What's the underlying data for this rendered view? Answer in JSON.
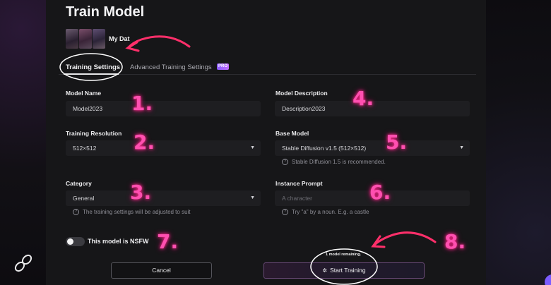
{
  "modal": {
    "title": "Train Model",
    "dataset_name": "My Dat",
    "tabs": [
      {
        "label": "Training Settings",
        "active": true
      },
      {
        "label": "Advanced Training Settings",
        "active": false
      }
    ],
    "pro_badge": "PRO"
  },
  "form": {
    "model_name": {
      "label": "Model Name",
      "value": "Model2023"
    },
    "model_description": {
      "label": "Model Description",
      "value": "Description2023"
    },
    "training_resolution": {
      "label": "Training Resolution",
      "value": "512×512"
    },
    "base_model": {
      "label": "Base Model",
      "value": "Stable Diffusion v1.5 (512×512)",
      "hint": "Stable Diffusion 1.5 is recommended."
    },
    "category": {
      "label": "Category",
      "value": "General",
      "hint": "The training settings will be adjusted to suit"
    },
    "instance_prompt": {
      "label": "Instance Prompt",
      "placeholder": "A character",
      "hint": "Try \"a\" by a noun. E.g. a castle"
    },
    "nsfw_toggle": {
      "label": "This model is NSFW",
      "on": false
    }
  },
  "footer": {
    "cancel_label": "Cancel",
    "remaining_text": "1 model remaining.",
    "start_label": "Start Training"
  },
  "annotations": {
    "numbers": [
      "1.",
      "2.",
      "3.",
      "4.",
      "5.",
      "6.",
      "7.",
      "8."
    ],
    "color": "#ff4fb0"
  },
  "icons": {
    "dropdown": "chevron-down-icon",
    "hint": "question-circle-icon",
    "start": "sparkle-icon",
    "brand": "brand-logo-icon"
  }
}
